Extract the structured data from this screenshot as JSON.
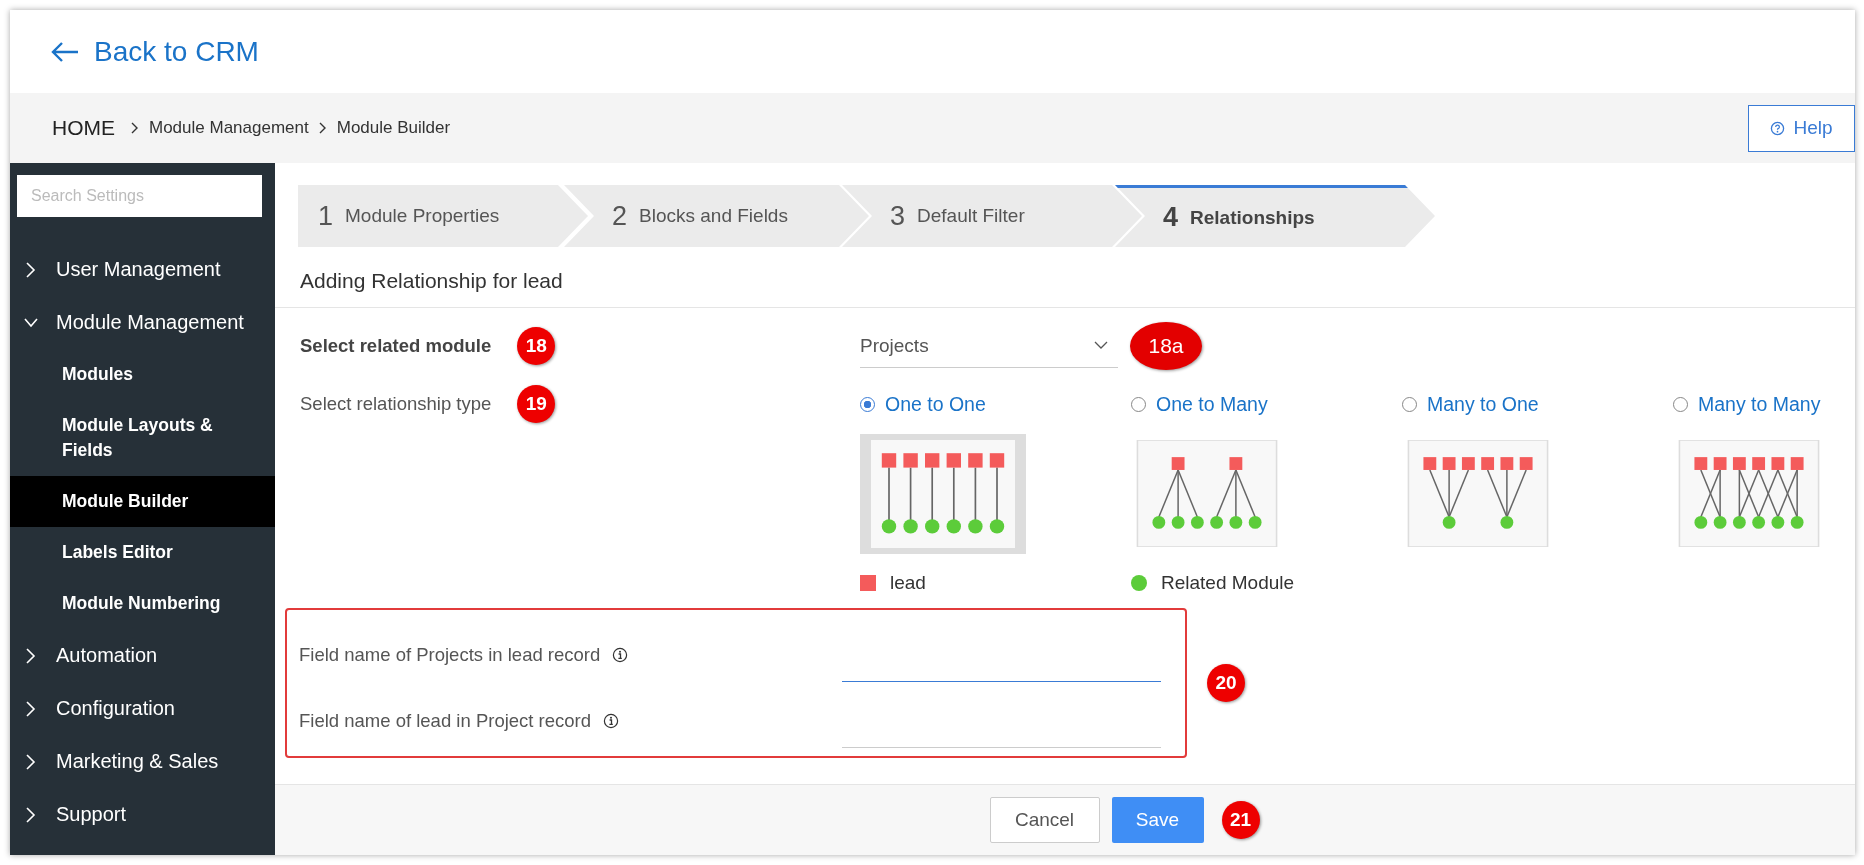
{
  "header": {
    "back_link": "Back to CRM"
  },
  "breadcrumb": {
    "home": "HOME",
    "items": [
      "Module Management",
      "Module Builder"
    ]
  },
  "help_button": "Help",
  "sidebar": {
    "search": {
      "placeholder": "Search Settings"
    },
    "items": [
      {
        "label": "User Management",
        "expanded": false
      },
      {
        "label": "Module Management",
        "expanded": true,
        "children": [
          {
            "label": "Modules",
            "selected": false
          },
          {
            "label": "Module Layouts & Fields",
            "selected": false
          },
          {
            "label": "Module Builder",
            "selected": true
          },
          {
            "label": "Labels Editor",
            "selected": false
          },
          {
            "label": "Module Numbering",
            "selected": false
          }
        ]
      },
      {
        "label": "Automation",
        "expanded": false
      },
      {
        "label": "Configuration",
        "expanded": false
      },
      {
        "label": "Marketing & Sales",
        "expanded": false
      },
      {
        "label": "Support",
        "expanded": false
      }
    ]
  },
  "steps": [
    {
      "number": "1",
      "label": "Module Properties",
      "selected": false
    },
    {
      "number": "2",
      "label": "Blocks and Fields",
      "selected": false
    },
    {
      "number": "3",
      "label": "Default Filter",
      "selected": false
    },
    {
      "number": "4",
      "label": "Relationships",
      "selected": true
    }
  ],
  "section_title": "Adding Relationship for lead",
  "related_module": {
    "label": "Select related module",
    "badge": "18",
    "value": "Projects",
    "badge_after": "18a"
  },
  "relationship_type": {
    "label": "Select relationship type",
    "badge": "19",
    "options": [
      {
        "label": "One to One",
        "kind": "one-to-one",
        "selected": true
      },
      {
        "label": "One to Many",
        "kind": "one-to-many",
        "selected": false
      },
      {
        "label": "Many to One",
        "kind": "many-to-one",
        "selected": false
      },
      {
        "label": "Many to Many",
        "kind": "many-to-many",
        "selected": false
      }
    ]
  },
  "legend": [
    {
      "label": "lead",
      "kind": "square"
    },
    {
      "label": "Related Module",
      "kind": "circle"
    }
  ],
  "field_names": {
    "highlighted": true,
    "badge": "20",
    "fields": [
      {
        "label": "Field name of Projects in lead record",
        "focused": true
      },
      {
        "label": "Field name of lead in Project record",
        "focused": false
      }
    ]
  },
  "footer": {
    "cancel": "Cancel",
    "save": "Save",
    "badge": "21"
  }
}
